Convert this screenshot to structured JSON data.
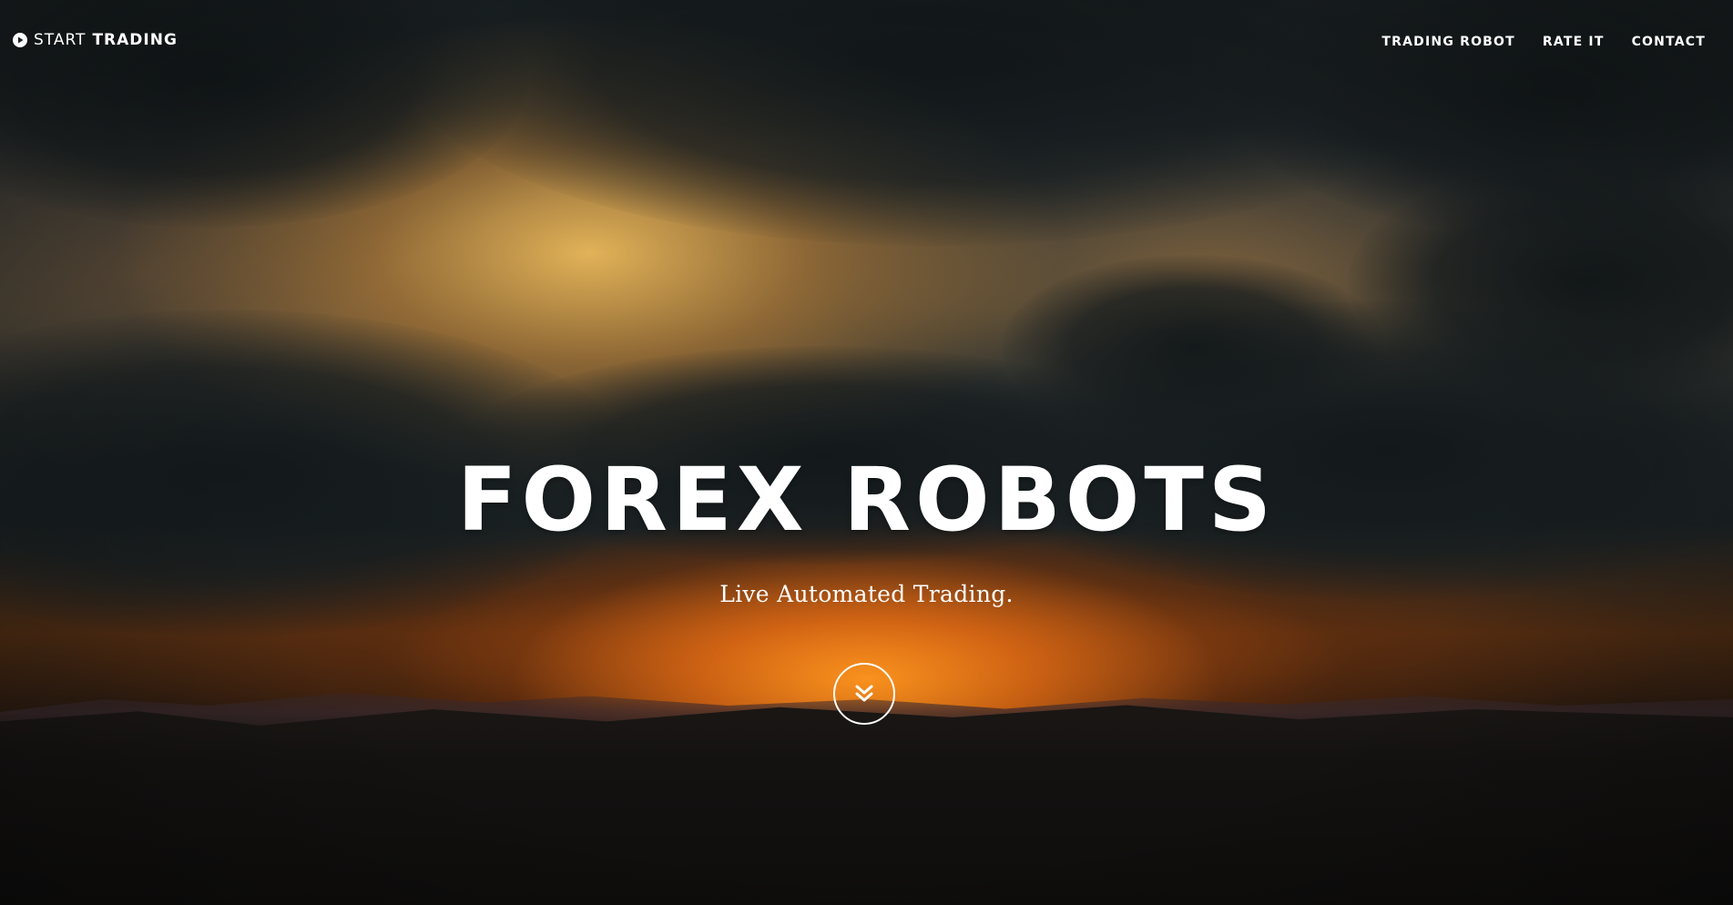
{
  "navbar": {
    "brand": {
      "icon": "play-circle-icon",
      "text_strong": "START",
      "text_light": "TRADING"
    },
    "links": [
      {
        "label": "TRADING ROBOT"
      },
      {
        "label": "RATE IT"
      },
      {
        "label": "CONTACT"
      }
    ]
  },
  "hero": {
    "title": "FOREX ROBOTS",
    "subtitle": "Live Automated Trading.",
    "scroll_button_icon": "double-chevron-down-icon",
    "background": "sunset-storm-clouds-over-hills"
  },
  "colors": {
    "text": "#ffffff",
    "sunset_orange": "#e8891c",
    "cloud_dark": "#1c2325"
  }
}
